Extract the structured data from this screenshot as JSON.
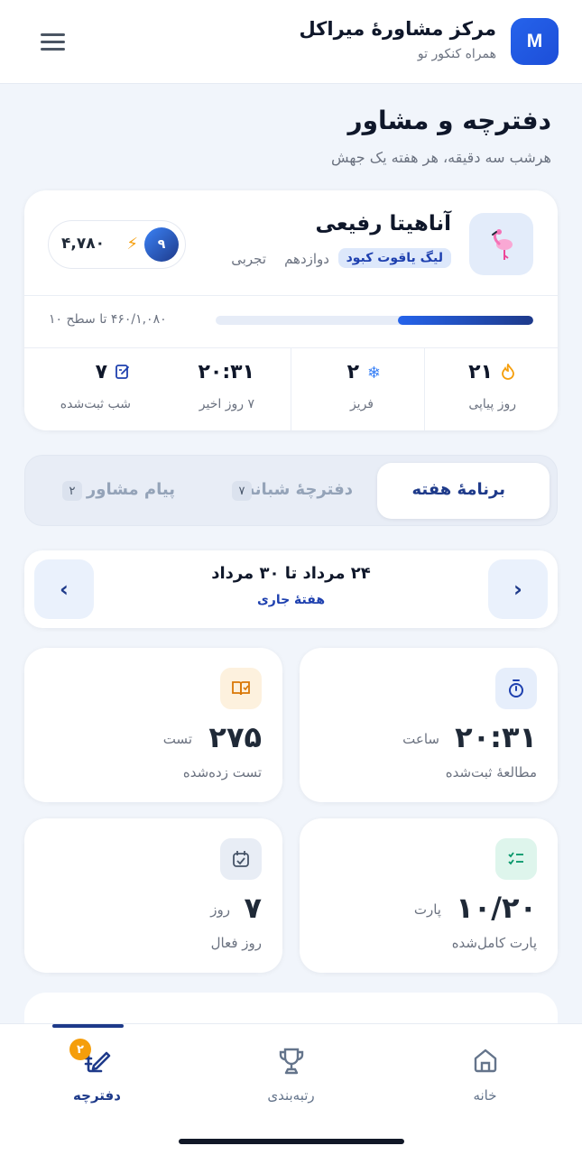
{
  "header": {
    "brand_initial": "M",
    "brand_name": "مرکز مشاورهٔ میراکل",
    "tagline": "همراه کنکور تو",
    "menu_icon": "hamburger-menu-icon"
  },
  "page": {
    "title": "دفترچه و مشاور",
    "subtitle": "هرشب سه دقیقه، هر هفته یک جهش"
  },
  "profile": {
    "avatar_icon": "flamingo-icon",
    "name": "آناهیتا رفیعی",
    "league": "لیگ یاقوت کبود",
    "grade": "دوازدهم",
    "field": "تجربی",
    "level": "۹",
    "xp": "۴,۷۸۰",
    "progress_text": "۴۶۰/۱,۰۸۰ تا سطح ۱۰",
    "progress_fraction": 0.426,
    "colors": {
      "accent": "#1e3a8a",
      "league_bg": "#dde8fb"
    }
  },
  "stats": [
    {
      "value": "۲۱",
      "label": "روز پیاپی",
      "icon": "flame-icon"
    },
    {
      "value": "۲",
      "label": "فریز",
      "icon": "snowflake-icon"
    },
    {
      "value": "۲۰:۳۱",
      "label": "۷ روز اخیر",
      "icon": ""
    },
    {
      "value": "۷",
      "label": "شب ثبت‌شده",
      "icon": "notebook-edit-icon"
    }
  ],
  "tabs": [
    {
      "label": "برنامهٔ هفته",
      "count": "",
      "active": true
    },
    {
      "label": "دفترچهٔ شبانه",
      "count": "۷",
      "active": false
    },
    {
      "label": "پیام مشاور",
      "count": "۲",
      "active": false
    }
  ],
  "week": {
    "range": "۲۴ مرداد تا ۳۰ مرداد",
    "label": "هفتهٔ جاری",
    "prev_icon": "chevron-right-icon",
    "next_icon": "chevron-left-icon"
  },
  "metrics": [
    {
      "value": "۲۰:۳۱",
      "unit": "ساعت",
      "label": "مطالعهٔ ثبت‌شده",
      "icon": "stopwatch-icon",
      "icon_color": "#1e40af",
      "icon_bg": "#e6eefb"
    },
    {
      "value": "۲۷۵",
      "unit": "تست",
      "label": "تست زده‌شده",
      "icon": "open-book-icon",
      "icon_color": "#d97706",
      "icon_bg": "#fdf1de"
    },
    {
      "value": "۱۰/۲۰",
      "unit": "پارت",
      "label": "پارت کامل‌شده",
      "icon": "checklist-icon",
      "icon_color": "#059669",
      "icon_bg": "#def5ec"
    },
    {
      "value": "۷",
      "unit": "روز",
      "label": "روز فعال",
      "icon": "calendar-check-icon",
      "icon_color": "#475569",
      "icon_bg": "#e8edf5"
    }
  ],
  "bottom_nav": [
    {
      "label": "خانه",
      "icon": "home-icon",
      "active": false,
      "badge": ""
    },
    {
      "label": "رتبه‌بندی",
      "icon": "trophy-icon",
      "active": false,
      "badge": ""
    },
    {
      "label": "دفترچه",
      "icon": "notebook-pen-icon",
      "active": true,
      "badge": "۲"
    }
  ]
}
